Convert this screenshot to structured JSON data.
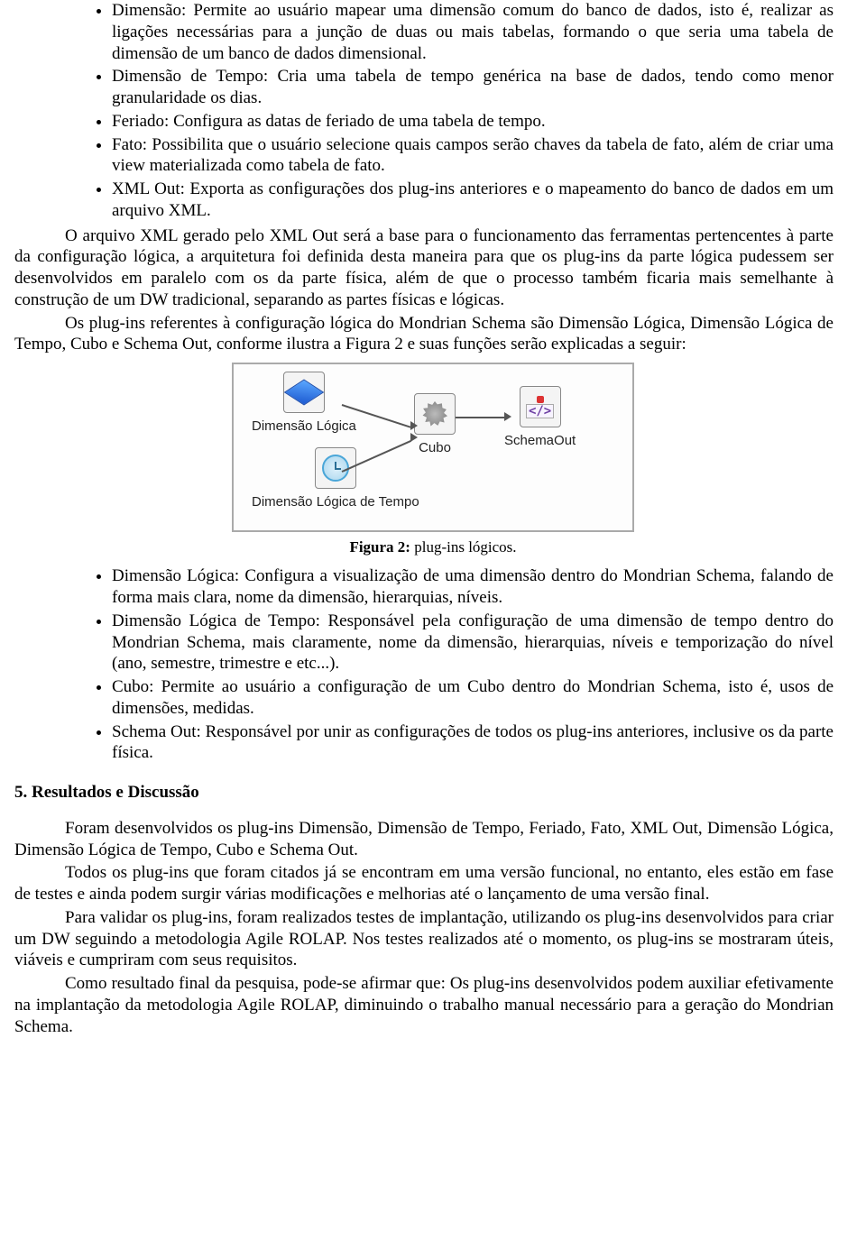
{
  "bullets1": [
    "Dimensão: Permite ao usuário mapear uma dimensão comum do banco de dados, isto é, realizar as ligações necessárias para a junção de duas ou mais tabelas, formando o que seria uma tabela de dimensão de um banco de dados dimensional.",
    "Dimensão de Tempo: Cria uma tabela de tempo genérica na base de dados, tendo como menor granularidade os dias.",
    "Feriado: Configura as datas de feriado de uma tabela de tempo.",
    "Fato: Possibilita que o usuário selecione quais campos serão chaves da tabela de fato, além de criar uma view materializada como tabela de fato.",
    "XML Out: Exporta as configurações dos plug-ins anteriores e o mapeamento do banco de dados em um arquivo XML."
  ],
  "para1": "O arquivo XML gerado pelo XML Out será a base para o funcionamento das ferramentas pertencentes à parte da configuração lógica, a arquitetura foi definida desta maneira para que os plug-ins da parte lógica pudessem ser desenvolvidos em paralelo com os da parte física, além de que o processo também ficaria mais semelhante à construção de um DW tradicional, separando as partes físicas e lógicas.",
  "para2": "Os plug-ins referentes à configuração lógica do Mondrian Schema são Dimensão Lógica, Dimensão Lógica de Tempo, Cubo e Schema Out, conforme ilustra a Figura 2 e suas funções serão explicadas a seguir:",
  "figure": {
    "nodes": {
      "n1": "Dimensão Lógica",
      "n2": "Dimensão Lógica de Tempo",
      "n3": "Cubo",
      "n4": "SchemaOut"
    },
    "caption_bold": "Figura 2:",
    "caption_rest": " plug-ins lógicos."
  },
  "bullets2": [
    "Dimensão Lógica: Configura a visualização de uma dimensão dentro do Mondrian Schema, falando de forma mais clara, nome da dimensão, hierarquias, níveis.",
    "Dimensão Lógica de Tempo: Responsável pela configuração de uma dimensão de tempo dentro do Mondrian Schema, mais claramente, nome da dimensão, hierarquias, níveis e temporização do nível (ano, semestre, trimestre e etc...).",
    "Cubo: Permite ao usuário a configuração de um Cubo dentro do Mondrian Schema, isto é, usos de dimensões, medidas.",
    "Schema Out: Responsável por unir as configurações de todos os plug-ins anteriores, inclusive os da parte física."
  ],
  "section5_heading": "5. Resultados e Discussão",
  "para3": "Foram desenvolvidos os plug-ins Dimensão, Dimensão de Tempo, Feriado, Fato, XML Out, Dimensão Lógica, Dimensão Lógica de Tempo, Cubo e Schema Out.",
  "para4": "Todos os plug-ins que foram citados já se encontram em uma versão funcional, no entanto, eles estão em fase de testes e ainda podem surgir várias modificações e melhorias até o lançamento de uma versão final.",
  "para5": "Para validar os plug-ins, foram realizados testes de implantação, utilizando os plug-ins desenvolvidos para criar um DW seguindo a metodologia Agile ROLAP. Nos testes realizados até o momento, os plug-ins se mostraram úteis, viáveis e cumpriram com seus requisitos.",
  "para6": "Como resultado final da pesquisa, pode-se afirmar que: Os plug-ins desenvolvidos podem auxiliar efetivamente na implantação da metodologia Agile ROLAP, diminuindo o trabalho manual necessário para a geração do Mondrian Schema."
}
